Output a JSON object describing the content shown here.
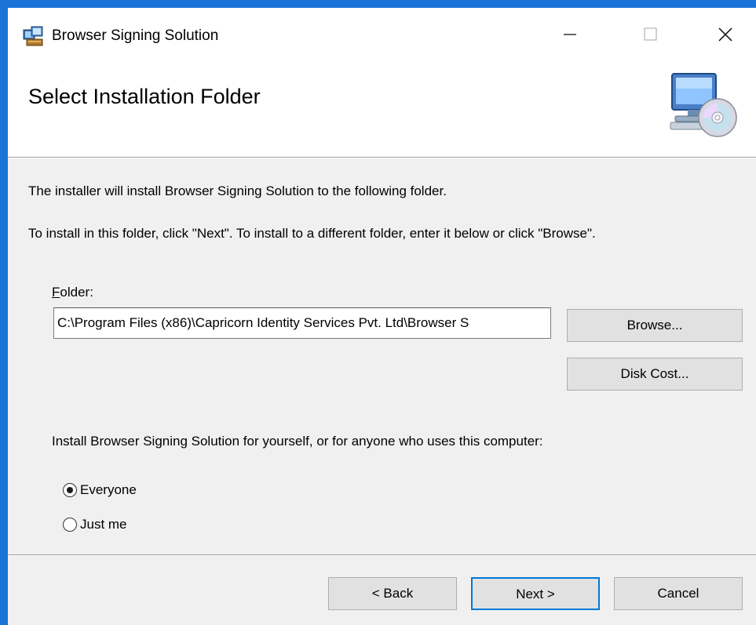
{
  "window": {
    "title": "Browser Signing Solution",
    "accent_color": "#1a73d9"
  },
  "header": {
    "title": "Select Installation Folder",
    "icon": "computer-cd-icon"
  },
  "body": {
    "intro_text": "The installer will install Browser Signing Solution to the following folder.",
    "instructions_text": "To install in this folder, click \"Next\". To install to a different folder, enter it below or click \"Browse\".",
    "folder_label_accel": "F",
    "folder_label_rest": "older:",
    "folder_value": "C:\\Program Files (x86)\\Capricorn Identity Services Pvt. Ltd\\Browser S",
    "browse_label": "Browse...",
    "disk_cost_label": "Disk Cost...",
    "scope_prompt": "Install Browser Signing Solution for yourself, or for anyone who uses this computer:",
    "options": [
      {
        "label": "Everyone",
        "selected": true
      },
      {
        "label": "Just me",
        "selected": false
      }
    ]
  },
  "footer": {
    "back_label": "< Back",
    "next_label": "Next >",
    "cancel_label": "Cancel"
  }
}
